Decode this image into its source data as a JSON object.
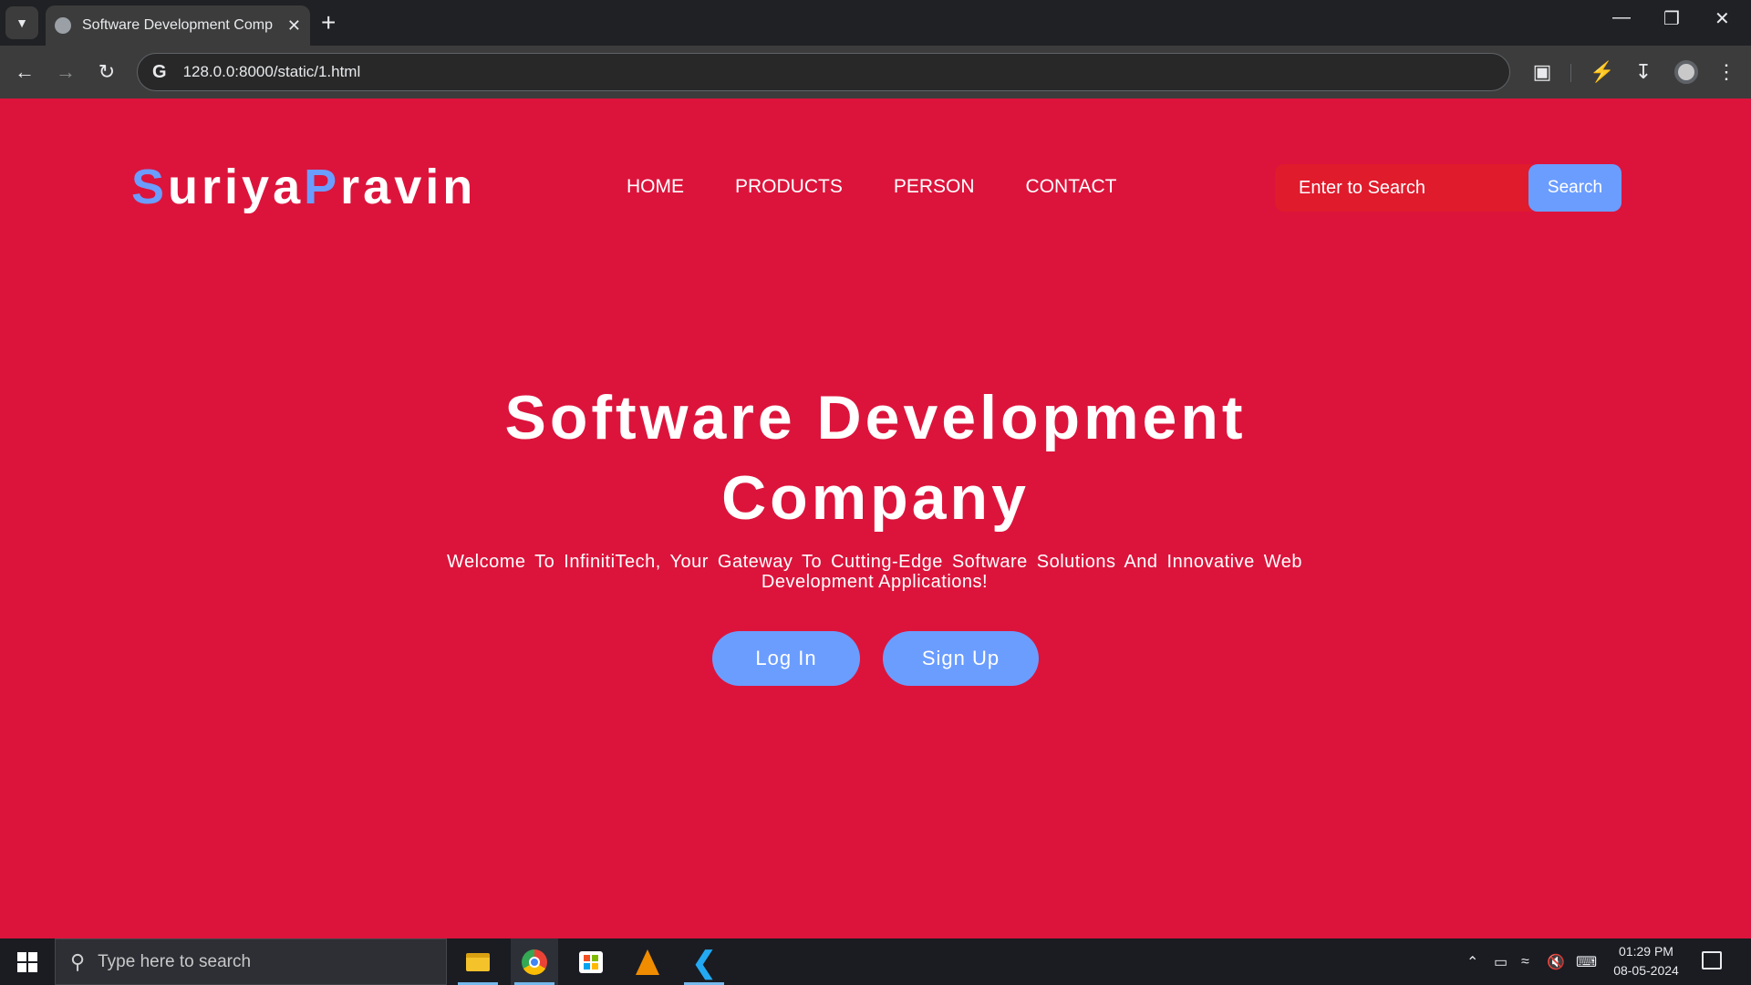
{
  "browser": {
    "tab_title": "Software Development Company",
    "tab_close": "✕",
    "new_tab": "+",
    "url": "128.0.0:8000/static/1.html",
    "window_controls": {
      "minimize": "—",
      "restore": "❐",
      "close": "✕"
    },
    "icons": [
      "tab-search-icon",
      "back-icon",
      "forward-icon",
      "reload-icon",
      "site-info-icon",
      "extensions-icon",
      "performance-icon",
      "download-icon",
      "profile-avatar",
      "menu-icon"
    ]
  },
  "page": {
    "logo": {
      "first_initial": "S",
      "first_rest": "uriya",
      "second_initial": "P",
      "second_rest": "ravin"
    },
    "nav": [
      {
        "label": "HOME"
      },
      {
        "label": "PRODUCTS"
      },
      {
        "label": "PERSON"
      },
      {
        "label": "CONTACT"
      }
    ],
    "search": {
      "placeholder": "Enter to Search",
      "button_label": "Search"
    },
    "hero": {
      "title_line1": "Software Development",
      "title_line2": "Company",
      "subtitle": "Welcome To InfinitiTech, Your Gateway To Cutting-Edge Software Solutions And Innovative Web Development Applications!",
      "login_label": "Log In",
      "signup_label": "Sign Up"
    },
    "colors": {
      "background": "#dc143c",
      "accent": "#6b9dff",
      "text": "#ffffff"
    }
  },
  "taskbar": {
    "search_placeholder": "Type here to search",
    "apps": [
      "file-explorer",
      "chrome",
      "microsoft-store",
      "vlc",
      "vscode"
    ],
    "time": "01:29 PM",
    "date": "08-05-2024"
  }
}
